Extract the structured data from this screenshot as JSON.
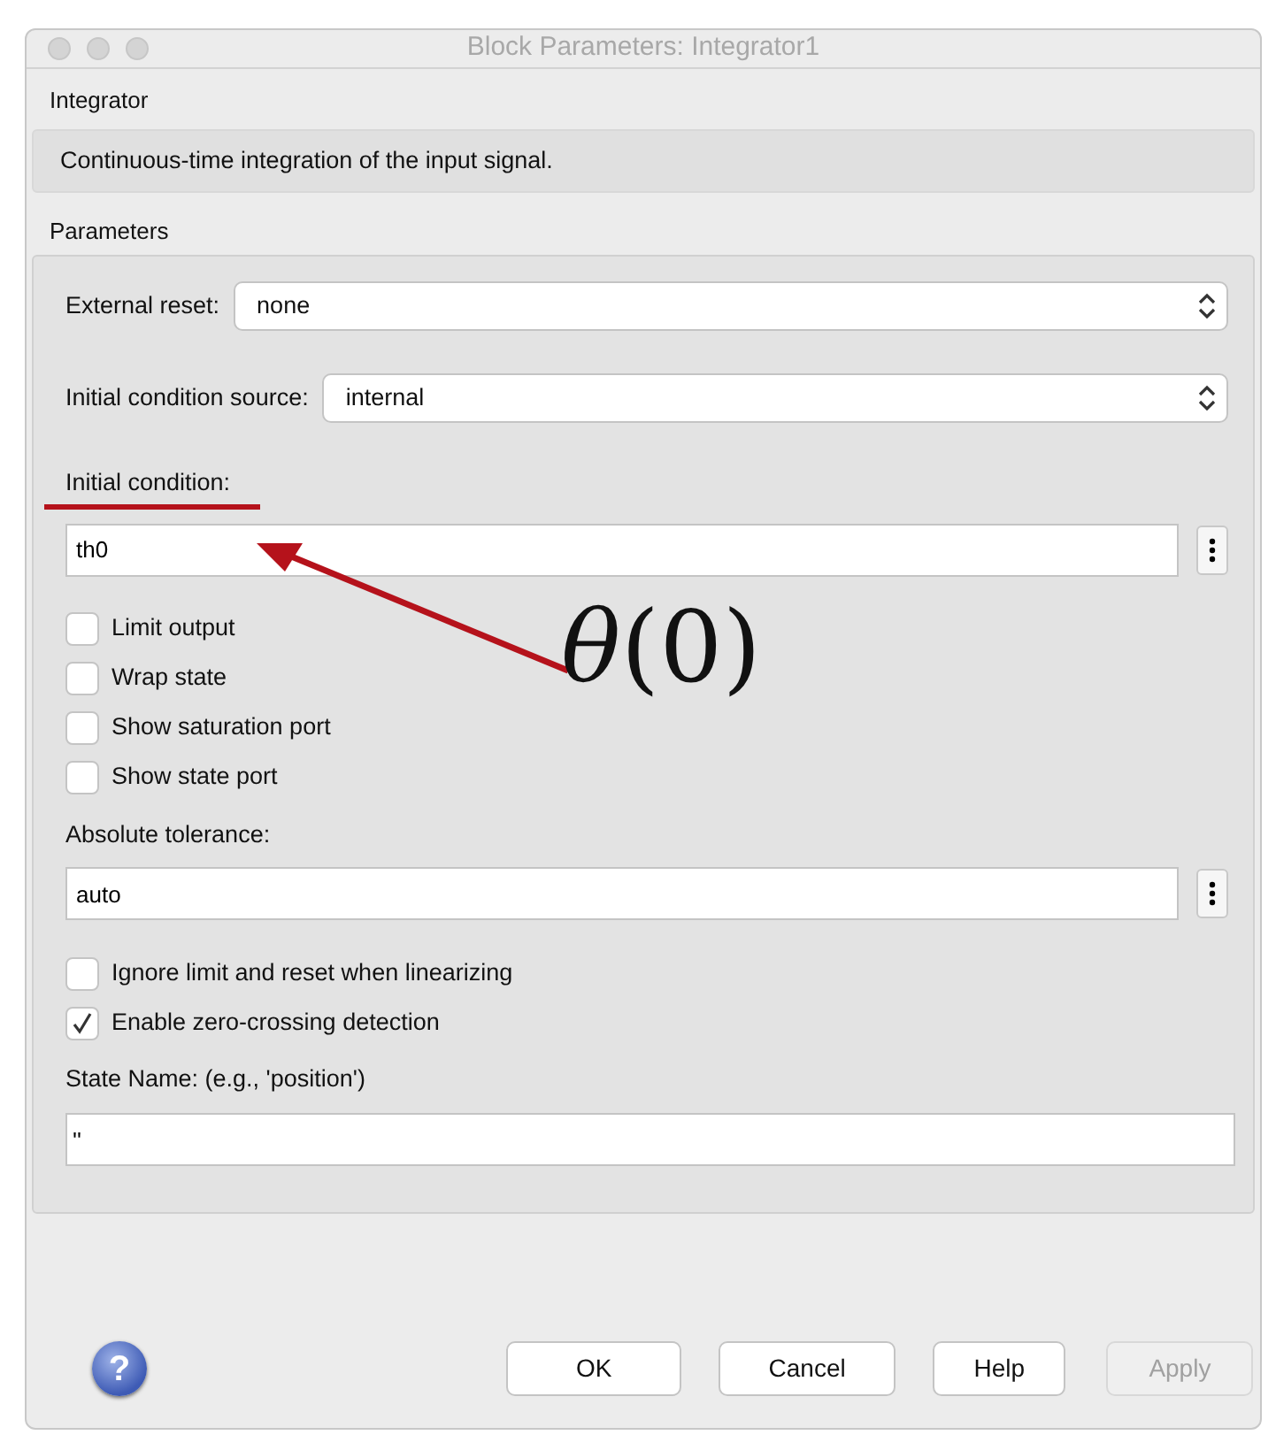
{
  "window": {
    "title": "Block Parameters: Integrator1"
  },
  "block": {
    "name": "Integrator",
    "description": "Continuous-time integration of the input signal."
  },
  "parameters": {
    "title": "Parameters",
    "items": [
      {
        "kind": "select",
        "label": "External reset:",
        "value": "none"
      },
      {
        "kind": "select",
        "label": "Initial condition source:",
        "value": "internal"
      },
      {
        "kind": "input",
        "label": "Initial condition:",
        "value": "th0",
        "annotated": true
      },
      {
        "kind": "checkbox",
        "label": "Limit output",
        "checked": false
      },
      {
        "kind": "checkbox",
        "label": "Wrap state",
        "checked": false
      },
      {
        "kind": "checkbox",
        "label": "Show saturation port",
        "checked": false
      },
      {
        "kind": "checkbox",
        "label": "Show state port",
        "checked": false
      },
      {
        "kind": "input",
        "label": "Absolute tolerance:",
        "value": "auto",
        "annotated": false
      },
      {
        "kind": "checkbox",
        "label": "Ignore limit and reset when linearizing",
        "checked": false
      },
      {
        "kind": "checkbox",
        "label": "Enable zero-crossing detection",
        "checked": true
      },
      {
        "kind": "text",
        "label": "State Name: (e.g., 'position')",
        "value": "''"
      }
    ]
  },
  "annotation": {
    "text": "*θ*(0)"
  },
  "help_icon": "?",
  "buttons": [
    {
      "label": "OK",
      "disabled": false
    },
    {
      "label": "Cancel",
      "disabled": false
    },
    {
      "label": "Help",
      "disabled": false
    },
    {
      "label": "Apply",
      "disabled": true
    }
  ]
}
